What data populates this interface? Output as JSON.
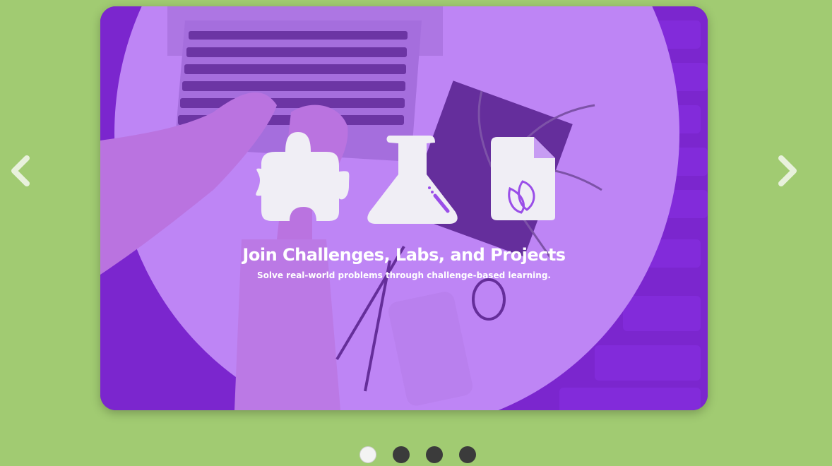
{
  "carousel": {
    "slide": {
      "title": "Join Challenges, Labs, and Projects",
      "subtitle": "Solve real-world problems through challenge-based learning.",
      "icons": [
        "puzzle-icon",
        "flask-icon",
        "document-leaf-icon"
      ]
    },
    "prev_icon": "chevron-left-icon",
    "next_icon": "chevron-right-icon",
    "dots": [
      {
        "name": "dot-1",
        "active": true
      },
      {
        "name": "dot-2",
        "active": false
      },
      {
        "name": "dot-3",
        "active": false
      },
      {
        "name": "dot-4",
        "active": false
      }
    ]
  },
  "colors": {
    "background": "#a1cb72",
    "overlay": "#9632f5",
    "text": "#ffffff",
    "dot_active": "#f3f3f3",
    "dot_inactive": "#3b3b3b"
  }
}
